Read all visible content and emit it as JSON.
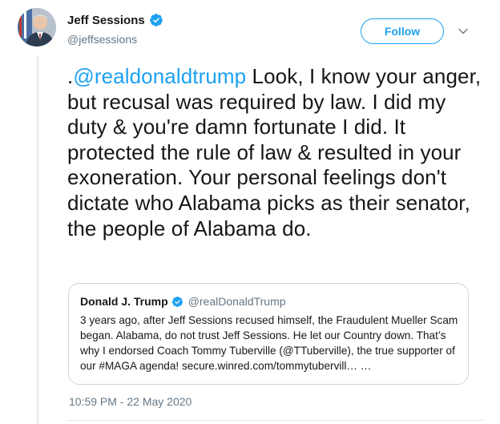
{
  "author": {
    "name": "Jeff Sessions",
    "handle": "@jeffsessions",
    "verified_icon": "verified-badge-icon",
    "avatar": "avatar-photo"
  },
  "header": {
    "follow_label": "Follow",
    "menu_icon": "chevron-down-icon"
  },
  "tweet": {
    "prefix": ".",
    "mention": "@realdonaldtrump",
    "text": " Look, I know your anger, but recusal was required by law. I did my duty & you're damn fortunate I did. It protected the rule of law & resulted in your exoneration. Your personal feelings don't dictate who Alabama picks as their senator, the people of Alabama do.",
    "timestamp": "10:59 PM - 22 May 2020"
  },
  "quote": {
    "name": "Donald J. Trump",
    "handle": "@realDonaldTrump",
    "text": "3 years ago, after Jeff Sessions recused himself, the Fraudulent Mueller Scam began. Alabama, do not trust Jeff Sessions. He let our Country down. That’s why I endorsed Coach Tommy Tuberville (@TTuberville), the true supporter of our #MAGA agenda! secure.winred.com/tommytubervill… …"
  },
  "colors": {
    "accent": "#1da1f2",
    "text": "#14171a",
    "muted": "#657786",
    "border": "#ccd6dd"
  }
}
